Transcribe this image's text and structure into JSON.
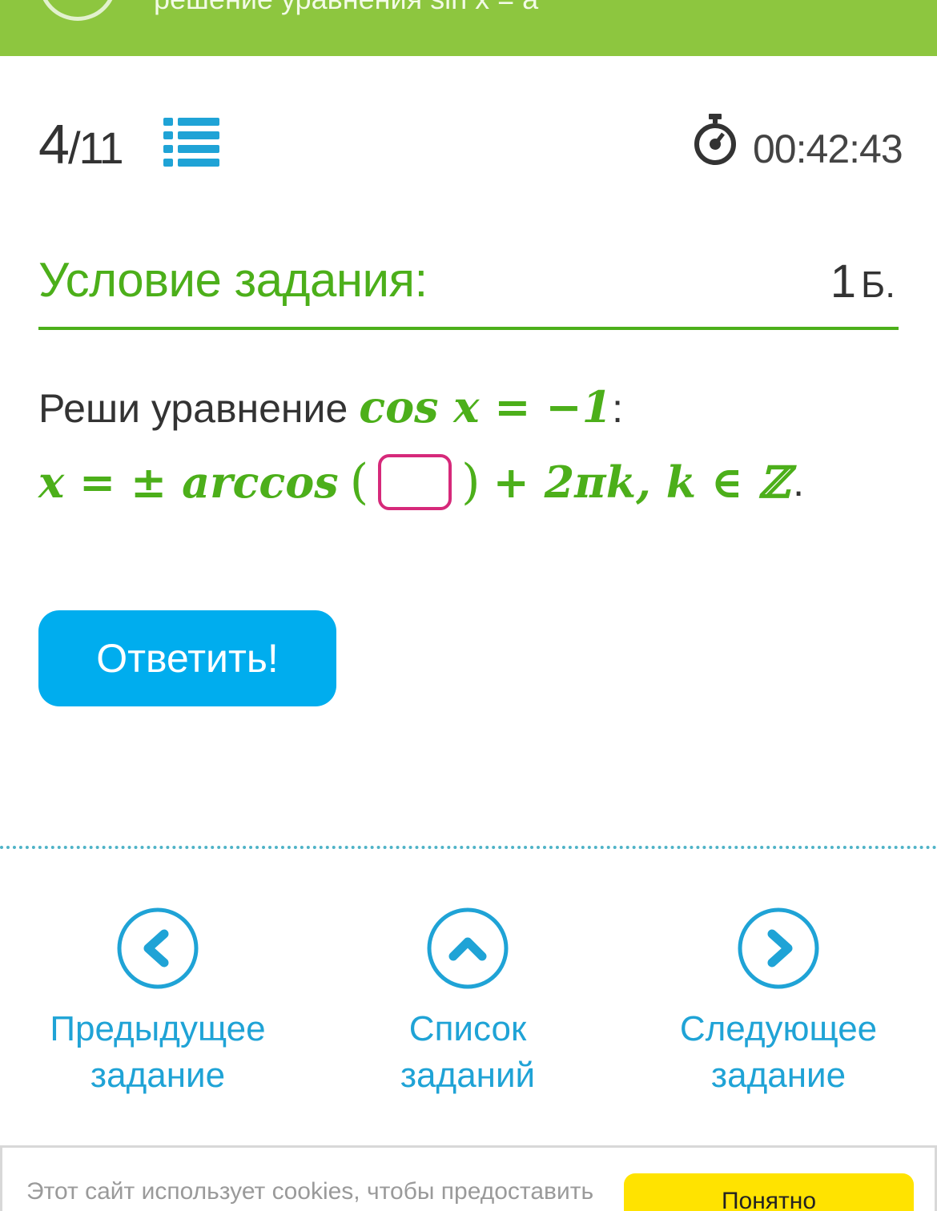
{
  "header": {
    "title": "решение уравнения sin x = a"
  },
  "progress": {
    "current": "4",
    "separator": "/",
    "total": "11"
  },
  "timer": {
    "value": "00:42:43"
  },
  "condition": {
    "title": "Условие задания:",
    "points": "1",
    "points_unit": "Б."
  },
  "task": {
    "prompt": "Реши уравнение",
    "equation": "cos x = −1",
    "colon": ":",
    "solution_prefix": "x = ± arccos",
    "open_paren": "(",
    "close_paren": ")",
    "solution_suffix": "+ 2πk, k ∈ ℤ",
    "end_period": ".",
    "answer_value": ""
  },
  "answer_button": {
    "label": "Ответить!"
  },
  "navigation": {
    "prev": {
      "line1": "Предыдущее",
      "line2": "задание"
    },
    "list": {
      "line1": "Список",
      "line2": "заданий"
    },
    "next": {
      "line1": "Следующее",
      "line2": "задание"
    }
  },
  "cookie": {
    "text": "Этот сайт использует cookies, чтобы предоставить",
    "button": "Понятно"
  },
  "colors": {
    "top_bar": "#8dc63f",
    "accent_green": "#4caf1a",
    "button_blue": "#00adee",
    "nav_blue": "#1fa3d6",
    "answer_box_border": "#d6297a",
    "cookie_button": "#ffe300"
  }
}
